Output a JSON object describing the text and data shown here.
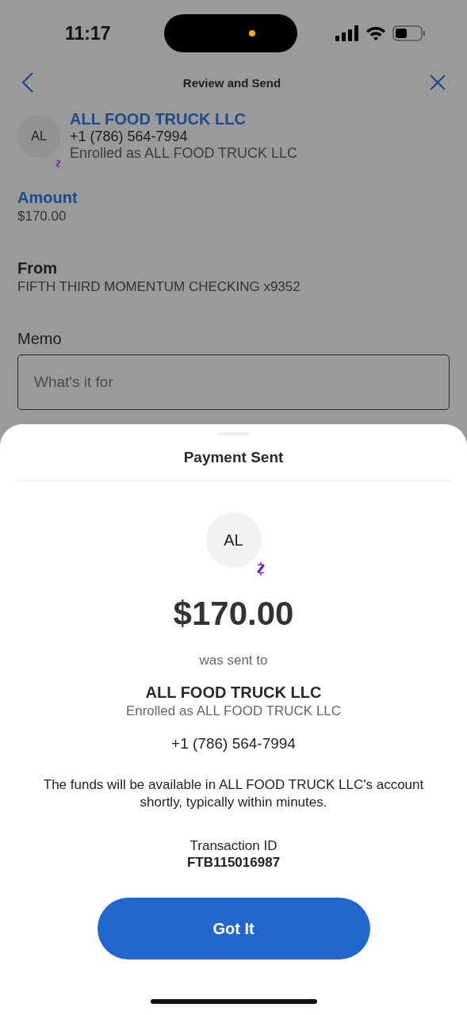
{
  "status_bar": {
    "time": "11:17"
  },
  "nav": {
    "title": "Review and Send"
  },
  "recipient": {
    "initials": "AL",
    "name": "ALL FOOD TRUCK LLC",
    "phone": "+1 (786) 564-7994",
    "enrolled": "Enrolled as ALL FOOD TRUCK LLC"
  },
  "amount": {
    "label": "Amount",
    "value": "$170.00"
  },
  "from": {
    "label": "From",
    "value": "FIFTH THIRD MOMENTUM CHECKING x9352"
  },
  "memo": {
    "label": "Memo",
    "placeholder": "What's it for"
  },
  "sheet": {
    "title": "Payment Sent",
    "initials": "AL",
    "amount": "$170.00",
    "sent_to": "was sent to",
    "name": "ALL FOOD TRUCK LLC",
    "enrolled": "Enrolled as ALL FOOD TRUCK LLC",
    "phone": "+1 (786) 564-7994",
    "message": "The funds will be available in ALL FOOD TRUCK LLC's account shortly, typically within minutes.",
    "transaction_label": "Transaction ID",
    "transaction_id": "FTB115016987",
    "button": "Got It"
  }
}
